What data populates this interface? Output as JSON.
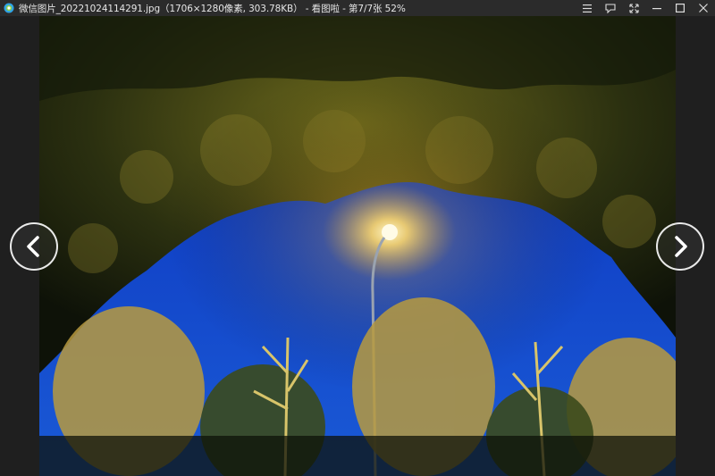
{
  "window": {
    "title": "微信图片_20221024114291.jpg（1706×1280像素, 303.78KB） - 看图啦 - 第7/7张 52%",
    "app_icon": "viewer-app-icon"
  },
  "controls": {
    "menu_icon": "menu-icon",
    "feedback_icon": "feedback-icon",
    "fullscreen_icon": "fullscreen-icon",
    "minimize_icon": "minimize-icon",
    "maximize_icon": "maximize-icon",
    "close_icon": "close-icon"
  },
  "navigation": {
    "prev_icon": "chevron-left-icon",
    "next_icon": "chevron-right-icon"
  },
  "image": {
    "subject": "night street lamp under tree canopy",
    "current_index": 7,
    "total": 7,
    "zoom_percent": 52
  }
}
